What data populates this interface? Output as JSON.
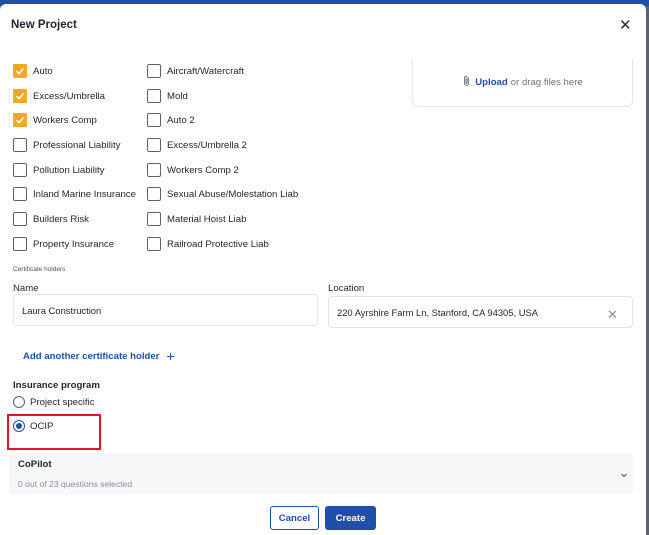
{
  "dialog": {
    "title": "New Project"
  },
  "coverages": {
    "left": [
      {
        "label": "Auto",
        "checked": true
      },
      {
        "label": "Excess/Umbrella",
        "checked": true
      },
      {
        "label": "Workers Comp",
        "checked": true
      },
      {
        "label": "Professional Liability",
        "checked": false
      },
      {
        "label": "Pollution Liability",
        "checked": false
      },
      {
        "label": "Inland Marine Insurance",
        "checked": false
      },
      {
        "label": "Builders Risk",
        "checked": false
      },
      {
        "label": "Property Insurance",
        "checked": false
      }
    ],
    "right": [
      {
        "label": "Aircraft/Watercraft",
        "checked": false
      },
      {
        "label": "Mold",
        "checked": false
      },
      {
        "label": "Auto 2",
        "checked": false
      },
      {
        "label": "Excess/Umbrella 2",
        "checked": false
      },
      {
        "label": "Workers Comp 2",
        "checked": false
      },
      {
        "label": "Sexual Abuse/Molestation Liab",
        "checked": false
      },
      {
        "label": "Material Hoist Liab",
        "checked": false
      },
      {
        "label": "Railroad Protective Liab",
        "checked": false
      }
    ]
  },
  "upload": {
    "link": "Upload",
    "text": "or drag files here"
  },
  "certificate_holders": {
    "section_label": "Certificate holders",
    "name_label": "Name",
    "name_value": "Laura Construction",
    "location_label": "Location",
    "location_value": "220 Ayrshire Farm Ln, Stanford, CA 94305, USA",
    "add_another": "Add another certificate holder"
  },
  "insurance_program": {
    "label": "Insurance program",
    "options": [
      {
        "label": "Project specific",
        "selected": false
      },
      {
        "label": "OCIP",
        "selected": true
      }
    ]
  },
  "copilot": {
    "title": "CoPilot",
    "summary": "0 out of 23 questions selected"
  },
  "buttons": {
    "cancel": "Cancel",
    "create": "Create"
  },
  "colors": {
    "accent": "#1f4fa8",
    "checked": "#f5a623",
    "highlight": "#e8102a"
  }
}
